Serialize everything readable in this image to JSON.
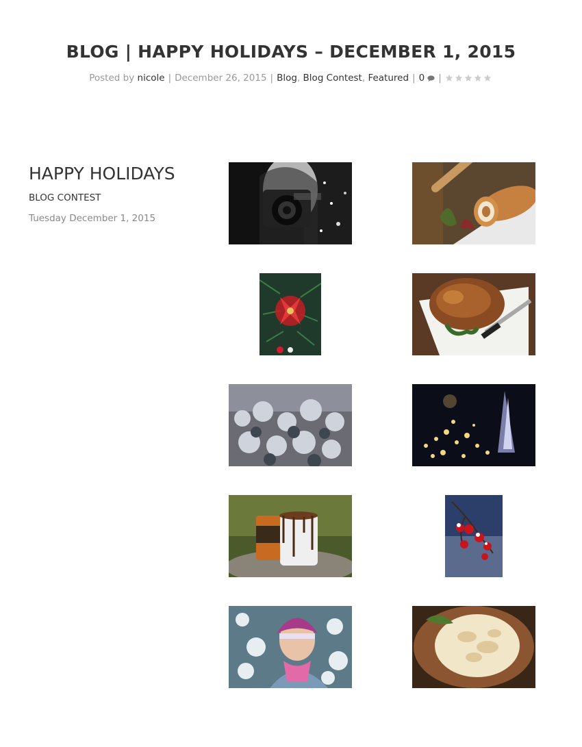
{
  "post": {
    "title": "BLOG | HAPPY HOLIDAYS – DECEMBER 1, 2015",
    "meta": {
      "posted_by_label": "Posted by",
      "author": "nicole",
      "separator": "|",
      "date": "December 26, 2015",
      "categories": [
        "Blog",
        "Blog Contest",
        "Featured"
      ],
      "category_separator": ",",
      "comment_count": "0",
      "comment_icon": "speech-bubble-icon",
      "rating_icon": "star-icon",
      "rating_stars_total": 5,
      "rating_value": 0
    }
  },
  "sidebar": {
    "heading": "HAPPY HOLIDAYS",
    "category": "BLOG CONTEST",
    "date": "Tuesday December 1, 2015"
  },
  "gallery": {
    "images": [
      {
        "subject": "camera-portrait-bw-photo"
      },
      {
        "subject": "pumpkin-roll-photo"
      },
      {
        "subject": "christmas-ornament-photo"
      },
      {
        "subject": "roast-chicken-photo"
      },
      {
        "subject": "frosted-branches-photo"
      },
      {
        "subject": "evening-lights-photo"
      },
      {
        "subject": "hot-chocolate-photo"
      },
      {
        "subject": "red-berries-photo"
      },
      {
        "subject": "winter-girl-photo"
      },
      {
        "subject": "meringue-pie-photo"
      }
    ]
  },
  "colors": {
    "title": "#333333",
    "meta_text": "#999999",
    "link": "#333333",
    "star": "#cccccc"
  }
}
